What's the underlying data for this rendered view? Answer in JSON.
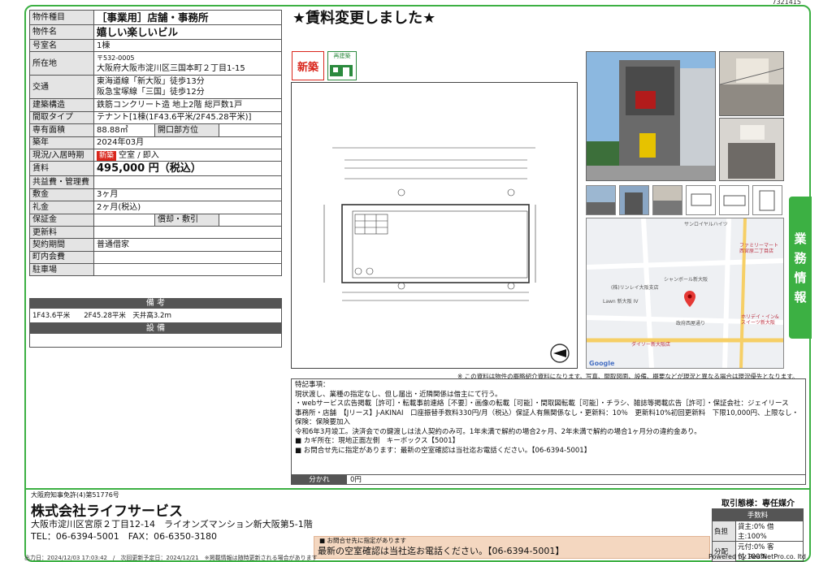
{
  "doc_id": "7321415",
  "spec_rows": [
    {
      "label": "物件種目",
      "value": "［事業用］店舗・事務所"
    },
    {
      "label": "物件名",
      "value": "嬉しい楽しいビル"
    },
    {
      "label": "号室名",
      "value": "1棟"
    },
    {
      "label": "所在地",
      "value": "〒532-0005",
      "value2": "大阪府大阪市淀川区三国本町２丁目1-15"
    },
    {
      "label": "交通",
      "value": "東海道線「新大阪」徒歩13分",
      "value2": "阪急宝塚線「三国」徒歩12分"
    },
    {
      "label": "建築構造",
      "value": "鉄筋コンクリート造 地上2階 総戸数1戸"
    },
    {
      "label": "間取タイプ",
      "value": "テナント[1棟(1F43.6平米/2F45.28平米)]"
    },
    {
      "label": "専有面積",
      "value": "88.88㎡",
      "sublabel": "開口部方位",
      "subvalue": ""
    },
    {
      "label": "築年",
      "value": "2024年03月"
    },
    {
      "label": "現況/入居時期",
      "tag": "新築",
      "value": "空室 / 即入"
    },
    {
      "label": "賃料",
      "value": "495,000 円（税込）"
    },
    {
      "label": "共益費・管理費",
      "value": ""
    },
    {
      "label": "敷金",
      "value": "3ヶ月"
    },
    {
      "label": "礼金",
      "value": "2ヶ月(税込)"
    },
    {
      "label": "保証金",
      "value": "",
      "sublabel": "償却・敷引",
      "subvalue": ""
    },
    {
      "label": "更新料",
      "value": ""
    },
    {
      "label": "契約期間",
      "value": "普通借家"
    },
    {
      "label": "町内会費",
      "value": ""
    },
    {
      "label": "駐車場",
      "value": ""
    }
  ],
  "notes_header": "備 考",
  "notes_text": "1F43.6平米　　2F45.28平米　天井高3.2ｍ",
  "facilities_header": "設 備",
  "headline": "★賃料変更しました★",
  "badge_new": "新築",
  "badge_rebuild": "再建築",
  "side_tab": [
    "業",
    "務",
    "情",
    "報"
  ],
  "disclaimer": "※ この資料は物件の概略紹介資料になります。写真、間取図面、設備、概要などが現況と異なる場合は現況優先となります。",
  "remarks_title": "特記事項：",
  "remarks_lines": [
    "現状渡し、業種の指定なし、但し届出・近隣関係は借主にて行う。",
    "・webサービス広告掲載［許可］・転載事前連絡［不要］・画像の転載［可能］・間取図転載［可能］・チラシ、雑誌等掲載広告［許可］・保証会社：ジェイリース　事務所・店舗　【Jリース】J-AKINAI　口座振替手数料330円/月（税込）保証人有無関係なし・更新料：10％　更新料10%初回更新料　下限10,000円、上限なし・保険：保険要加入",
    "令和6年3月竣工。決済会での鍵渡しは法人契約のみ可。1年未満で解約の場合2ヶ月、2年未満で解約の場合1ヶ月分の違約金あり。",
    "■ カギ所在：現地正面左側　キーボックス【5001】",
    "■ お問合せ先に指定があります：最新の空室確認は当社迄お電話ください。【06-6394-5001】"
  ],
  "rent_free_label": "分かれ",
  "rent_free_value": "0円",
  "license": "大阪府知事免許(4)第51776号",
  "company": "株式会社ライフサービス",
  "address": "大阪市淀川区宮原２丁目12-14　ライオンズマンション新大阪第5-1階",
  "tel": "TEL：06-6394-5001　FAX：06-6350-3180",
  "callbox_small": "■ お問合せ先に指定があります",
  "callbox_main": "最新の空室確認は当社迄お電話ください。【06-6394-5001】",
  "fee": {
    "title": "取引態様：専任媒介",
    "header": "手数料",
    "rows": [
      {
        "k": "負担",
        "v": "貸主:0% 借主:100%"
      },
      {
        "k": "分配",
        "v": "元付:0% 客付:100%"
      }
    ]
  },
  "map_labels": [
    "サンロイヤルハイツ",
    "ファミリーマート 西宮原二丁目店",
    "シャンボール新大阪",
    "(株)リンレイ大阪支店",
    "Lawn 新大阪 IV",
    "ホリデイ・イン&スイーツ新大阪",
    "ダイソー新大阪店",
    "政府西屋通り",
    "Google"
  ],
  "bottom_line": "出力日：2024/12/03 17:03:42　/　次回更新予定日：2024/12/21　※掲載情報は随時更新される場合があります",
  "powered": "Powered by RealNetPro.co. ltd"
}
